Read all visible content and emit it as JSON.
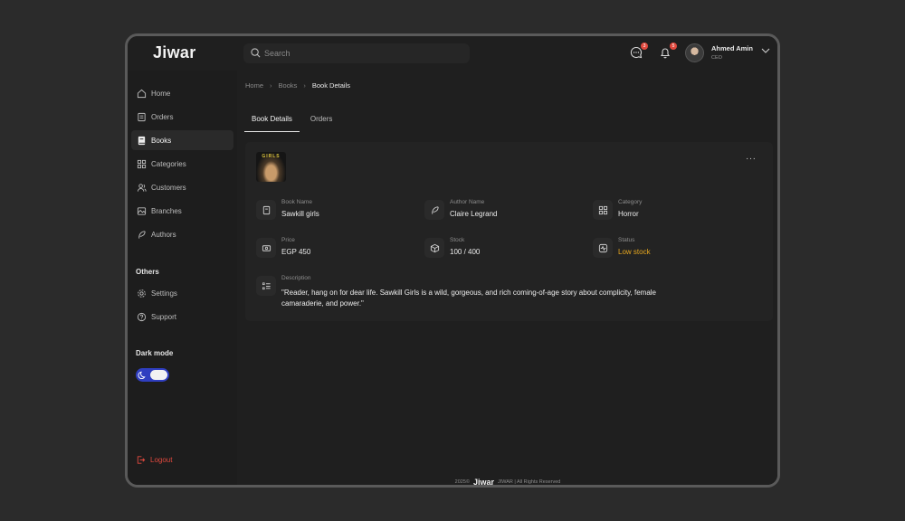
{
  "brand": {
    "logo_text": "Jiwar"
  },
  "search": {
    "placeholder": "Search"
  },
  "header": {
    "messages_badge": "3",
    "notifications_badge": "5",
    "user": {
      "name": "Ahmed Amin",
      "role": "CEO"
    }
  },
  "sidebar": {
    "items": [
      {
        "label": "Home",
        "icon": "home-icon"
      },
      {
        "label": "Orders",
        "icon": "orders-icon"
      },
      {
        "label": "Books",
        "icon": "book-icon",
        "active": true
      },
      {
        "label": "Categories",
        "icon": "categories-icon"
      },
      {
        "label": "Customers",
        "icon": "customers-icon"
      },
      {
        "label": "Branches",
        "icon": "branches-icon"
      },
      {
        "label": "Authors",
        "icon": "feather-icon"
      }
    ],
    "others_label": "Others",
    "others": [
      {
        "label": "Settings",
        "icon": "gear-icon"
      },
      {
        "label": "Support",
        "icon": "help-icon"
      }
    ],
    "dark_mode_label": "Dark mode",
    "dark_mode_on": true,
    "logout_label": "Logout"
  },
  "breadcrumb": [
    "Home",
    "Books",
    "Book Details"
  ],
  "tabs": [
    {
      "label": "Book Details",
      "active": true
    },
    {
      "label": "Orders",
      "active": false
    }
  ],
  "book": {
    "cover_title": "GIRLS",
    "fields": [
      {
        "label": "Book Name",
        "value": "Sawkill girls",
        "icon": "book-icon"
      },
      {
        "label": "Author Name",
        "value": "Claire Legrand",
        "icon": "feather-icon"
      },
      {
        "label": "Category",
        "value": "Horror",
        "icon": "categories-icon"
      },
      {
        "label": "Price",
        "value": "EGP 450",
        "icon": "money-icon"
      },
      {
        "label": "Stock",
        "value": "100 / 400",
        "icon": "box-icon"
      },
      {
        "label": "Status",
        "value": "Low stock",
        "icon": "status-icon",
        "color": "#e8a81f"
      }
    ],
    "description_label": "Description",
    "description": "\"Reader, hang on for dear life. Sawkill Girls is a wild, gorgeous, and rich coming-of-age story about complicity, female camaraderie, and power.\""
  },
  "footer": {
    "year": "2025©",
    "logo": "Jiwar",
    "text": "JIWAR | All Rights Reserved"
  },
  "colors": {
    "accent": "#2f3ec0",
    "danger": "#e0493e",
    "warning": "#e8a81f",
    "background": "#1d1d1d"
  }
}
